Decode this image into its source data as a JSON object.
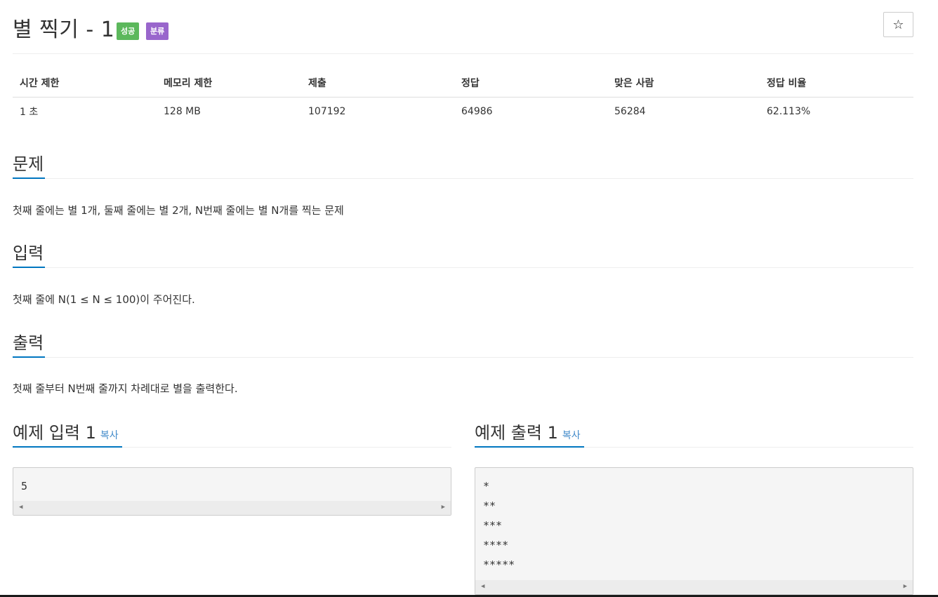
{
  "problem": {
    "title": "별 찍기 - 1",
    "badges": {
      "success": "성공",
      "category": "분류"
    },
    "star_icon": "☆"
  },
  "info_table": {
    "headers": [
      "시간 제한",
      "메모리 제한",
      "제출",
      "정답",
      "맞은 사람",
      "정답 비율"
    ],
    "values": [
      "1 초",
      "128 MB",
      "107192",
      "64986",
      "56284",
      "62.113%"
    ]
  },
  "sections": {
    "problem": {
      "heading": "문제",
      "text": "첫째 줄에는 별 1개, 둘째 줄에는 별 2개, N번째 줄에는 별 N개를 찍는 문제"
    },
    "input": {
      "heading": "입력",
      "text": "첫째 줄에 N(1 ≤ N ≤ 100)이 주어진다."
    },
    "output": {
      "heading": "출력",
      "text": "첫째 줄부터 N번째 줄까지 차례대로 별을 출력한다."
    }
  },
  "samples": {
    "input": {
      "heading": "예제 입력 1",
      "copy_label": "복사",
      "content": "5"
    },
    "output": {
      "heading": "예제 출력 1",
      "copy_label": "복사",
      "content": "*\n**\n***\n****\n*****"
    }
  },
  "scroll_arrows": {
    "left": "◀",
    "right": "▶"
  }
}
